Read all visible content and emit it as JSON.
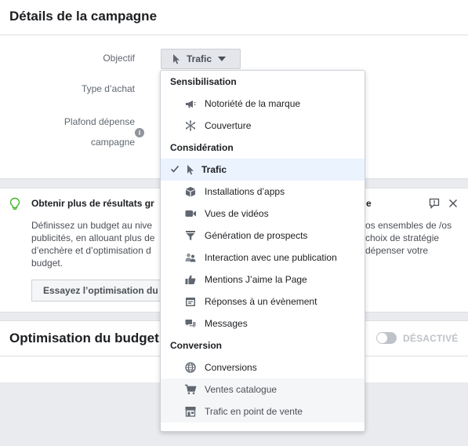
{
  "campaign": {
    "title": "Détails de la campagne",
    "objective_label": "Objectif",
    "objective_value": "Trafic",
    "purchase_type_label": "Type d’achat",
    "spend_cap_label_line1": "Plafond dépense",
    "spend_cap_label_line2": "campagne"
  },
  "tip": {
    "title_left": "Obtenir plus de résultats gr",
    "title_right": "e",
    "body_left": "Définissez un budget au nive publicités, en allouant plus de d’enchère et d’optimisation d budget.",
    "body_right": "os ensembles de /os choix de stratégie dépenser votre",
    "button_label": "Essayez l’optimisation du"
  },
  "budget_opt": {
    "title": "Optimisation du budget c",
    "toggle_label": "DÉSACTIVÉ"
  },
  "menu": {
    "groups": [
      {
        "name": "Sensibilisation",
        "items": [
          {
            "label": "Notoriété de la marque",
            "icon": "megaphone-icon"
          },
          {
            "label": "Couverture",
            "icon": "reach-icon"
          }
        ]
      },
      {
        "name": "Considération",
        "items": [
          {
            "label": "Trafic",
            "icon": "cursor-icon"
          },
          {
            "label": "Installations d’apps",
            "icon": "box-icon"
          },
          {
            "label": "Vues de vidéos",
            "icon": "video-camera-icon"
          },
          {
            "label": "Génération de prospects",
            "icon": "funnel-icon"
          },
          {
            "label": "Interaction avec une publication",
            "icon": "people-icon"
          },
          {
            "label": "Mentions J’aime la Page",
            "icon": "thumbs-up-icon"
          },
          {
            "label": "Réponses à un évènement",
            "icon": "calendar-icon"
          },
          {
            "label": "Messages",
            "icon": "chat-bubbles-icon"
          }
        ]
      },
      {
        "name": "Conversion",
        "items": [
          {
            "label": "Conversions",
            "icon": "globe-icon"
          },
          {
            "label": "Ventes catalogue",
            "icon": "cart-icon"
          },
          {
            "label": "Trafic en point de vente",
            "icon": "store-icon"
          }
        ]
      }
    ]
  },
  "colors": {
    "background": "#e9ebee",
    "selected_row": "#ebf3ff",
    "icon_gray": "#606770",
    "tip_bulb": "#42b72a"
  }
}
